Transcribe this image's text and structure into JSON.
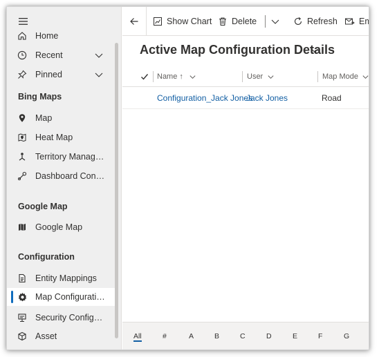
{
  "sidebar": {
    "items": [
      {
        "label": "Home",
        "icon": "home-icon"
      },
      {
        "label": "Recent",
        "icon": "clock-icon"
      },
      {
        "label": "Pinned",
        "icon": "pin-icon"
      }
    ],
    "sections": [
      {
        "title": "Bing Maps",
        "items": [
          {
            "label": "Map",
            "icon": "map-marker-icon"
          },
          {
            "label": "Heat Map",
            "icon": "heat-map-icon"
          },
          {
            "label": "Territory Management",
            "display": "Territory Manage...",
            "icon": "territory-icon"
          },
          {
            "label": "Dashboard Configuration",
            "display": "Dashboard Config...",
            "icon": "dashboard-config-icon"
          }
        ]
      },
      {
        "title": "Google Map",
        "items": [
          {
            "label": "Google Map",
            "icon": "folded-map-icon"
          }
        ]
      },
      {
        "title": "Configuration",
        "items": [
          {
            "label": "Entity Mappings",
            "icon": "document-icon"
          },
          {
            "label": "Map Configuration",
            "display": "Map Configuratio...",
            "icon": "gear-icon",
            "selected": true
          },
          {
            "label": "Security Configuration",
            "display": "Security Configur...",
            "icon": "security-config-icon"
          },
          {
            "label": "Asset",
            "icon": "cube-icon"
          }
        ]
      }
    ]
  },
  "toolbar": {
    "show_chart": "Show Chart",
    "delete": "Delete",
    "refresh": "Refresh",
    "email": "Emai"
  },
  "page": {
    "title": "Active Map Configuration Details"
  },
  "grid": {
    "columns": [
      "Name ↑",
      "User",
      "Map Mode"
    ],
    "rows": [
      {
        "name": "Configuration_Jack Jones",
        "user": "Jack Jones",
        "map_mode": "Road"
      }
    ]
  },
  "jumpbar": {
    "letters": [
      "All",
      "#",
      "A",
      "B",
      "C",
      "D",
      "E",
      "F",
      "G"
    ],
    "active": "All"
  },
  "colors": {
    "accent": "#0f6cbd",
    "link": "#115ea3",
    "sidebar_bg": "#efefef"
  }
}
